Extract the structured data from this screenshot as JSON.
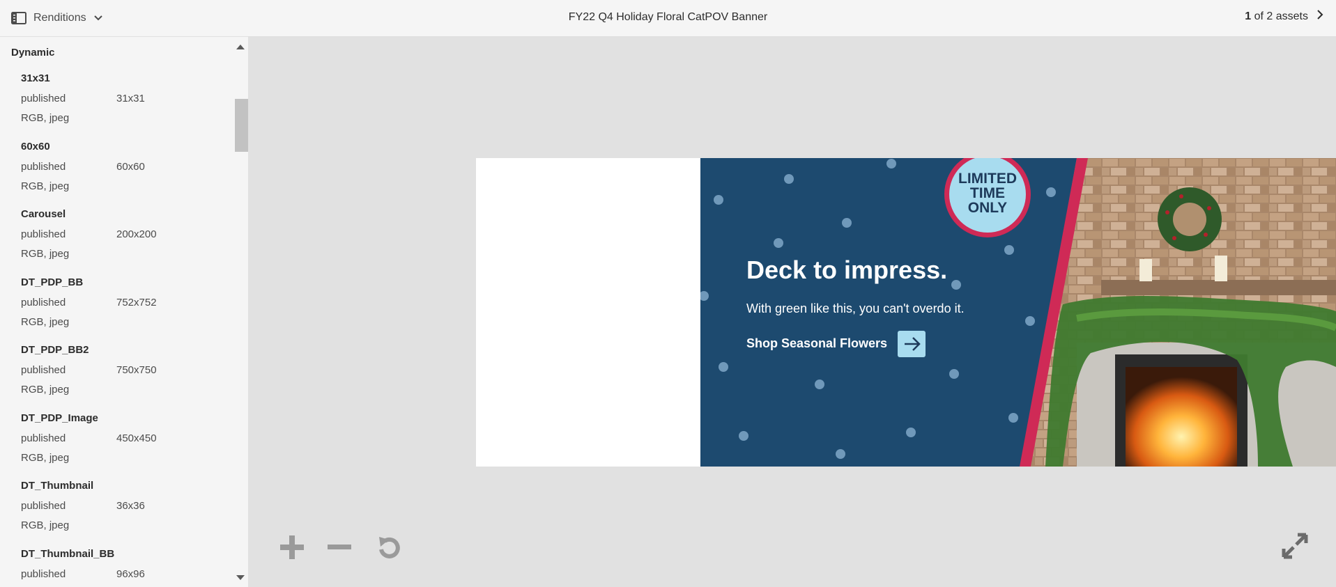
{
  "header": {
    "renditions_label": "Renditions",
    "title": "FY22 Q4 Holiday Floral CatPOV Banner",
    "pager_current": "1",
    "pager_rest": "of 2 assets"
  },
  "sidebar": {
    "heading": "Dynamic",
    "items": [
      {
        "name": "31x31",
        "status": "published",
        "size": "31x31",
        "format": "RGB, jpeg"
      },
      {
        "name": "60x60",
        "status": "published",
        "size": "60x60",
        "format": "RGB, jpeg"
      },
      {
        "name": "Carousel",
        "status": "published",
        "size": "200x200",
        "format": "RGB, jpeg"
      },
      {
        "name": "DT_PDP_BB",
        "status": "published",
        "size": "752x752",
        "format": "RGB, jpeg"
      },
      {
        "name": "DT_PDP_BB2",
        "status": "published",
        "size": "750x750",
        "format": "RGB, jpeg"
      },
      {
        "name": "DT_PDP_Image",
        "status": "published",
        "size": "450x450",
        "format": "RGB, jpeg"
      },
      {
        "name": "DT_Thumbnail",
        "status": "published",
        "size": "36x36",
        "format": "RGB, jpeg"
      },
      {
        "name": "DT_Thumbnail_BB",
        "status": "published",
        "size": "96x96",
        "format": ""
      }
    ]
  },
  "banner": {
    "badge_line1": "LIMITED",
    "badge_line2": "TIME",
    "badge_line3": "ONLY",
    "headline": "Deck to impress.",
    "subline": "With green like this, you can't overdo it.",
    "cta": "Shop Seasonal Flowers"
  },
  "icons": {
    "renditions": "panel-icon",
    "dropdown": "chevron-down-icon",
    "next": "chevron-right-icon",
    "zoom_in": "plus-icon",
    "zoom_out": "minus-icon",
    "reset": "reset-icon",
    "fullscreen": "fullscreen-icon"
  },
  "colors": {
    "banner_blue": "#1d4a6f",
    "badge_fill": "#a8dcef",
    "glitter": "#cf2a56"
  }
}
